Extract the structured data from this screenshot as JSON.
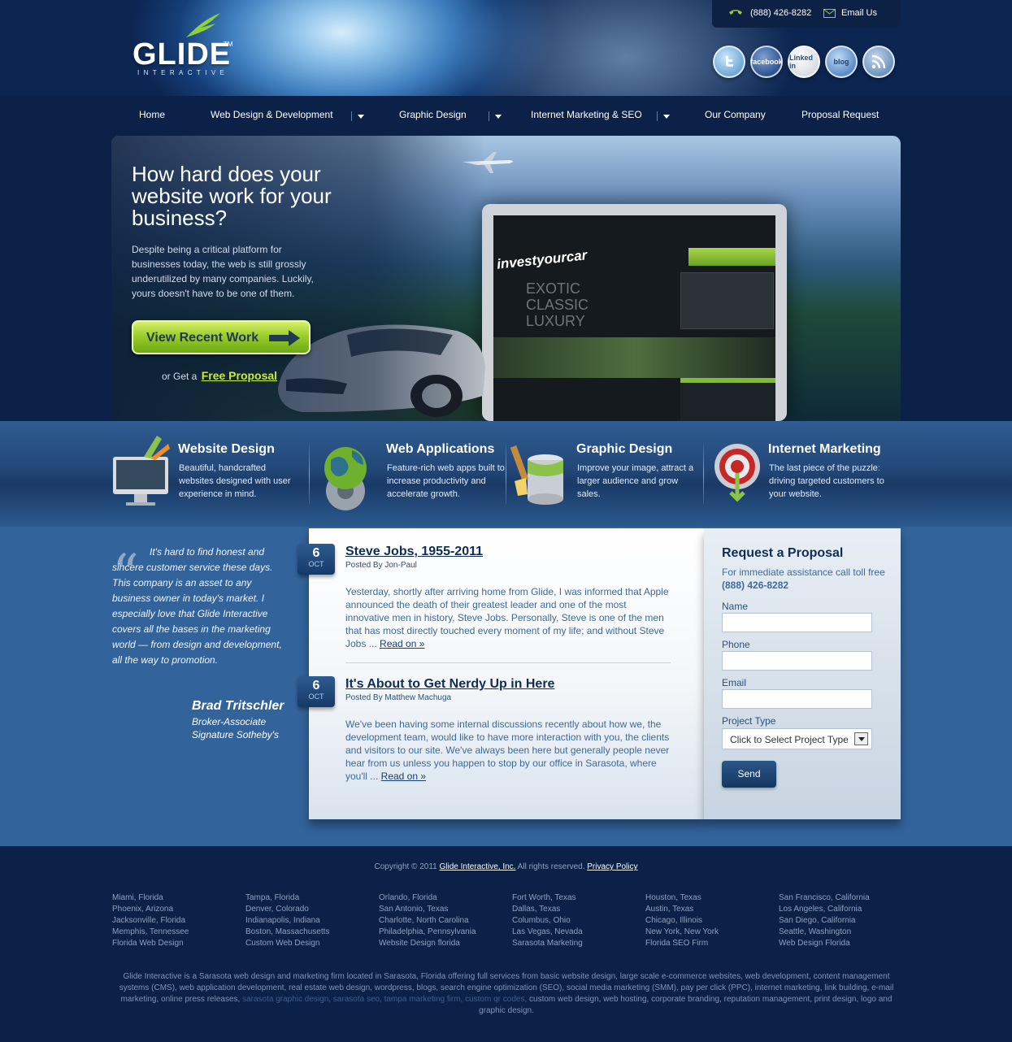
{
  "header": {
    "logo_word": "GLIDE",
    "logo_tm": "TM",
    "logo_sub": "INTERACTIVE",
    "phone": "(888) 426-8282",
    "email_label": "Email Us",
    "social": [
      {
        "name": "twitter",
        "label": "",
        "color": "#6fa8d6"
      },
      {
        "name": "facebook",
        "label": "facebook",
        "color": "#3c64a8"
      },
      {
        "name": "linkedin",
        "label": "Linked in",
        "color": "#f2f4f7"
      },
      {
        "name": "blog",
        "label": "blog",
        "color": "#6b9bd2"
      },
      {
        "name": "rss",
        "label": "",
        "color": "#7d9fc6"
      }
    ]
  },
  "nav": {
    "items": [
      {
        "label": "Home",
        "dropdown": false
      },
      {
        "label": "Web Design & Development",
        "dropdown": true
      },
      {
        "label": "Graphic Design",
        "dropdown": true
      },
      {
        "label": "Internet Marketing & SEO",
        "dropdown": true
      },
      {
        "label": "Our Company",
        "dropdown": false
      },
      {
        "label": "Proposal Request",
        "dropdown": false
      }
    ]
  },
  "hero": {
    "headline": "How hard does your website work for your business?",
    "lead": "Despite being a critical platform for businesses today, the web is still grossly underutilized by many companies. Luckily, yours doesn't have to be one of them.",
    "cta_label": "View Recent Work",
    "alt_prefix": "or Get a",
    "alt_link": "Free Proposal",
    "screen_brand": "investyourcar",
    "screen_words": [
      "EXOTIC",
      "CLASSIC",
      "LUXURY"
    ]
  },
  "services": [
    {
      "title": "Website Design",
      "text": "Beautiful, handcrafted websites designed with user experience in mind.",
      "icon": "monitor-icon"
    },
    {
      "title": "Web Applications",
      "text": "Feature-rich web apps built to increase productivity and accelerate growth.",
      "icon": "globe-gear-icon"
    },
    {
      "title": "Graphic Design",
      "text": "Improve your image, attract a larger audience and grow sales.",
      "icon": "paint-can-icon"
    },
    {
      "title": "Internet Marketing",
      "text": "The last piece of the puzzle: driving targeted customers to your website.",
      "icon": "target-icon"
    }
  ],
  "testimonial": {
    "text": "It's hard to find honest and sincere customer service these days. This company is an asset to any business owner in today's market. I especially love that Glide Interactive covers all the bases in the marketing world — from design and development, all the way to promotion.",
    "name": "Brad Tritschler",
    "role1": "Broker-Associate",
    "role2": "Signature Sotheby's"
  },
  "posts": [
    {
      "day": "6",
      "month": "OCT",
      "title": "Steve Jobs, 1955-2011",
      "byline": "Posted By Jon-Paul",
      "excerpt": "Yesterday, shortly after arriving home from Glide, I was informed that Apple announced the death of their greatest leader and one of the most innovative men in history, Steve Jobs. Personally, Steve is one of the men that has most directly touched every moment of my life; and without Steve Jobs ...",
      "more": "Read on »"
    },
    {
      "day": "6",
      "month": "OCT",
      "title": "It's About to Get Nerdy Up in Here",
      "byline": "Posted By Matthew Machuga",
      "excerpt": "We've been having some internal discussions recently about how we, the development team, would like to have more interaction with you, the clients and visitors to our site.  We've always been here but generally people never hear from us unless you happen to stop by our office in Sarasota, where you'll ...",
      "more": "Read on »"
    }
  ],
  "proposal": {
    "title": "Request a Proposal",
    "note": "For immediate assistance call toll free",
    "phone": "(888) 426-8282",
    "name_label": "Name",
    "phone_label": "Phone",
    "email_label": "Email",
    "type_label": "Project Type",
    "type_value": "Click to Select Project Type",
    "send_label": "Send"
  },
  "footer": {
    "copyright_prefix": "Copyright © 2011",
    "company_link": "Glide Interactive, Inc.",
    "rights": "All rights reserved.",
    "privacy": "Privacy Policy",
    "city_columns": [
      [
        "Miami, Florida",
        "Phoenix, Arizona",
        "Jacksonville, Florida",
        "Memphis, Tennessee",
        "Florida Web Design"
      ],
      [
        "Tampa, Florida",
        "Denver, Colorado",
        "Indianapolis, Indiana",
        "Boston, Massachusetts",
        "Custom Web Design"
      ],
      [
        "Orlando, Florida",
        "San Antonio, Texas",
        "Charlotte, North Carolina",
        "Philadelphia, Pennsylvania",
        "Website Design florida"
      ],
      [
        "Fort Worth, Texas",
        "Dallas, Texas",
        "Columbus, Ohio",
        "Las Vegas, Nevada",
        "Sarasota Marketing"
      ],
      [
        "Houston, Texas",
        "Austin, Texas",
        "Chicago, Illinois",
        "New York, New York",
        "Florida SEO Firm"
      ],
      [
        "San Francisco, California",
        "Los Angeles, California",
        "San Diego, California",
        "Seattle, Washington",
        "Web Design Florida"
      ]
    ],
    "about_a": "Glide Interactive is a Sarasota web design and marketing firm located in Sarasota, Florida offering full services from basic website design, large scale e-commerce websites, web development, content management systems (CMS), web application development, real estate web design, wordpress, blogs, search engine optimization (SEO), social media marketing (SMM), pay per click (PPC), internet marketing, link building, e-mail marketing, online press releases,",
    "about_links": "sarasota graphic design, sarasota seo, tampa marketing firm, custom qr codes,",
    "about_b": "custom web design, web hosting, corporate branding, reputation management, print design, logo and graphic design."
  }
}
